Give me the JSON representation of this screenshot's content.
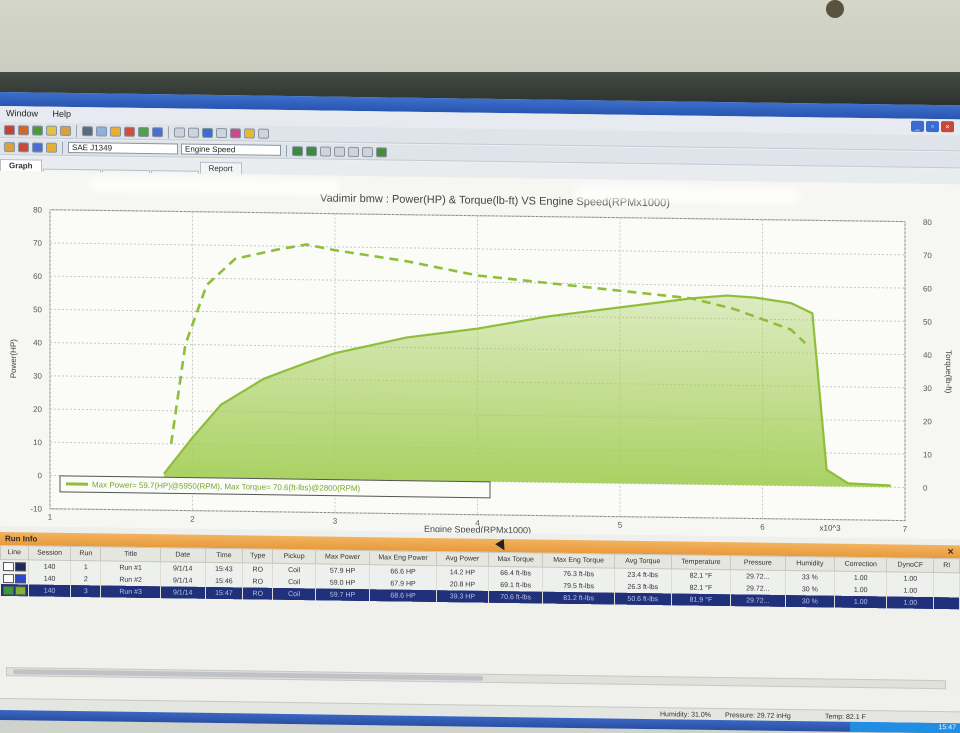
{
  "menu": [
    "Window",
    "Help"
  ],
  "toolbar": {
    "correction_standard": "SAE J1349",
    "x_axis_select": "Engine Speed"
  },
  "tabs": [
    "Graph",
    "",
    "",
    "",
    "Report"
  ],
  "chart_data": {
    "type": "line",
    "title": "Vadimir bmw : Power(HP) & Torque(lb-ft) VS Engine Speed(RPMx1000)",
    "xlabel": "Engine Speed(RPMx1000)",
    "ylabel_left": "Power(HP)",
    "ylabel_right": "Torque(lb-ft)",
    "xlim": [
      1,
      7
    ],
    "ylim": [
      -10,
      80
    ],
    "x_ticks": [
      "1",
      "2",
      "3",
      "4",
      "5",
      "6",
      "7"
    ],
    "x_scale_note": "x10^3",
    "y_ticks": [
      "-10",
      "0",
      "10",
      "20",
      "30",
      "40",
      "50",
      "60",
      "70",
      "80"
    ],
    "grid": true,
    "legend_text": "Max Power= 59.7(HP)@5950(RPM), Max Torque= 70.6(ft-lbs)@2800(RPM)",
    "legend_position": "bottom-left",
    "colors": {
      "power": "#8fbf3a",
      "torque": "#8fbf3a",
      "fill": "#a6cf5c"
    },
    "series": [
      {
        "name": "Power",
        "style": "solid-filled",
        "x": [
          1.8,
          2.0,
          2.2,
          2.5,
          2.8,
          3.0,
          3.5,
          4.0,
          4.5,
          5.0,
          5.5,
          5.75,
          5.95,
          6.2,
          6.35,
          6.45,
          6.6,
          6.9
        ],
        "values": [
          1,
          12,
          22,
          30,
          35,
          38,
          43,
          46,
          50,
          53,
          56,
          57,
          56.5,
          55,
          52,
          5,
          1,
          0.5
        ]
      },
      {
        "name": "Torque",
        "style": "dashed",
        "x": [
          1.85,
          1.95,
          2.1,
          2.3,
          2.6,
          2.8,
          3.0,
          3.5,
          4.0,
          4.5,
          5.0,
          5.5,
          5.8,
          6.0,
          6.2,
          6.3
        ],
        "values": [
          10,
          40,
          58,
          66,
          69,
          70.6,
          69,
          66,
          62,
          60,
          58,
          56,
          53,
          50,
          47,
          43
        ]
      }
    ]
  },
  "run_info": {
    "title": "Run Info",
    "columns": [
      "Line",
      "Session",
      "Run",
      "Title",
      "Date",
      "Time",
      "Type",
      "Pickup",
      "Max Power",
      "Max Eng Power",
      "Avg Power",
      "Max Torque",
      "Max Eng Torque",
      "Avg Torque",
      "Temperature",
      "Pressure",
      "Humidity",
      "Correction",
      "DynoCF",
      "RI"
    ],
    "rows": [
      {
        "swatch": "#1e2b5a",
        "session": "140",
        "run": "1",
        "title": "Run #1",
        "date": "9/1/14",
        "time": "15:43",
        "type": "RO",
        "pickup": "Coil",
        "max_power": "57.9 HP",
        "max_eng_power": "66.6 HP",
        "avg_power": "14.2 HP",
        "max_torque": "66.4 ft-lbs",
        "max_eng_torque": "76.3 ft-lbs",
        "avg_torque": "23.4 ft-lbs",
        "temperature": "82.1 °F",
        "pressure": "29.72...",
        "humidity": "33 %",
        "correction": "1.00",
        "dynocf": "1.00",
        "selected": false
      },
      {
        "swatch": "#2d47c8",
        "session": "140",
        "run": "2",
        "title": "Run #2",
        "date": "9/1/14",
        "time": "15:46",
        "type": "RO",
        "pickup": "Coil",
        "max_power": "59.0 HP",
        "max_eng_power": "67.9 HP",
        "avg_power": "20.8 HP",
        "max_torque": "69.1 ft-lbs",
        "max_eng_torque": "79.5 ft-lbs",
        "avg_torque": "26.3 ft-lbs",
        "temperature": "82.1 °F",
        "pressure": "29.72...",
        "humidity": "30 %",
        "correction": "1.00",
        "dynocf": "1.00",
        "selected": false
      },
      {
        "swatch": "#7fb23a",
        "session": "140",
        "run": "3",
        "title": "Run #3",
        "date": "9/1/14",
        "time": "15:47",
        "type": "RO",
        "pickup": "Coil",
        "max_power": "59.7 HP",
        "max_eng_power": "68.6 HP",
        "avg_power": "39.3 HP",
        "max_torque": "70.6 ft-lbs",
        "max_eng_torque": "81.2 ft-lbs",
        "avg_torque": "50.6 ft-lbs",
        "temperature": "81.9 °F",
        "pressure": "29.72...",
        "humidity": "30 %",
        "correction": "1.00",
        "dynocf": "1.00",
        "selected": true
      }
    ]
  },
  "status": {
    "humidity": "Humidity: 31.0%",
    "pressure": "Pressure: 29.72 inHg",
    "temp": "Temp: 82.1 F",
    "clock": "15:47"
  }
}
